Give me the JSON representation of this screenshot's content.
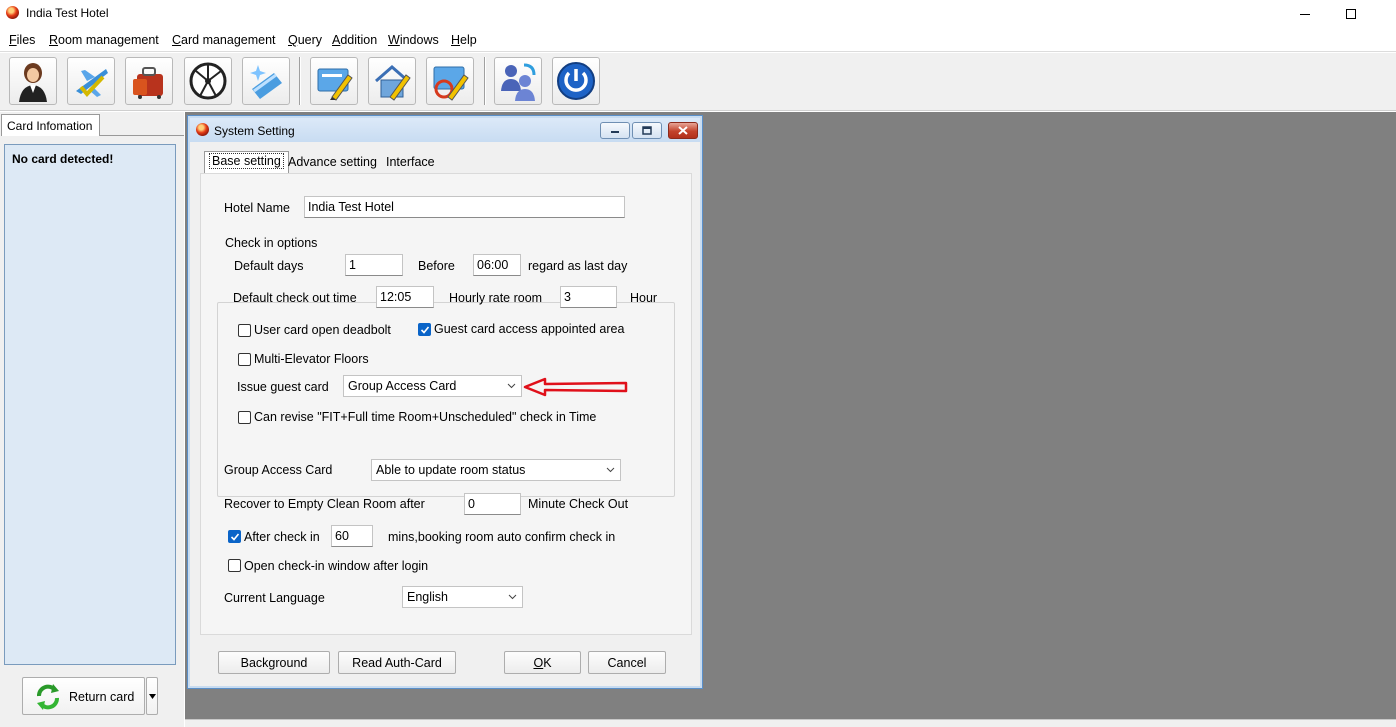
{
  "app": {
    "title": "India Test Hotel"
  },
  "menu": [
    {
      "accel": "F",
      "rest": "iles"
    },
    {
      "accel": "R",
      "rest": "oom management"
    },
    {
      "accel": "C",
      "rest": "ard management"
    },
    {
      "accel": "Q",
      "rest": "uery"
    },
    {
      "accel": "A",
      "rest": "ddition"
    },
    {
      "accel": "W",
      "rest": "indows"
    },
    {
      "accel": "H",
      "rest": "elp"
    }
  ],
  "toolbar_icons": [
    "receptionist-icon",
    "flight-check-icon",
    "luggage-icon",
    "roulette-icon",
    "sparkle-card-icon",
    "edit-card-icon",
    "house-edit-icon",
    "refresh-card-icon",
    "users-swap-icon",
    "power-icon"
  ],
  "left_panel": {
    "tab_label": "Card Infomation",
    "message": "No card detected!",
    "return_button": "Return card"
  },
  "dialog": {
    "title": "System Setting",
    "tabs": [
      "Base setting",
      "Advance setting",
      "Interface"
    ],
    "hotel_name_label": "Hotel Name",
    "hotel_name_value": "India Test Hotel",
    "group_label": "Check in options",
    "default_days_label": "Default days",
    "default_days_value": "1",
    "before_label": "Before",
    "before_value": "06:00",
    "last_day_label": "regard as last day",
    "checkout_time_label": "Default check out time",
    "checkout_time_value": "12:05",
    "hourly_label": "Hourly rate room",
    "hourly_value": "3",
    "hour_label": "Hour",
    "chk_deadbolt": {
      "label": "User card open deadbolt",
      "checked": false
    },
    "chk_appointed": {
      "label": "Guest card access appointed area",
      "checked": true
    },
    "chk_elevator": {
      "label": "Multi-Elevator Floors",
      "checked": false
    },
    "issue_label": "Issue guest card",
    "issue_value": "Group Access Card",
    "chk_revise": {
      "label": "Can revise \"FIT+Full time Room+Unscheduled\" check in Time",
      "checked": false
    },
    "group_access_label": "Group Access Card",
    "group_access_value": "Able to update room status",
    "recover_label": "Recover to Empty Clean Room after",
    "recover_value": "0",
    "minute_label": "Minute Check Out",
    "chk_after": {
      "label": "After check in",
      "checked": true
    },
    "after_value": "60",
    "mins_label": "mins,booking room auto confirm check in",
    "chk_open": {
      "label": "Open check-in window after login",
      "checked": false
    },
    "language_label": "Current Language",
    "language_value": "English",
    "buttons": {
      "background": "Background",
      "read_auth": "Read Auth-Card",
      "ok_accel": "O",
      "ok_rest": "K",
      "cancel": "Cancel"
    }
  },
  "colors": {
    "accent": "#0a64c8",
    "workspace": "#808080",
    "card_panel": "#dde9f5",
    "annotation_arrow": "#e0101a"
  }
}
